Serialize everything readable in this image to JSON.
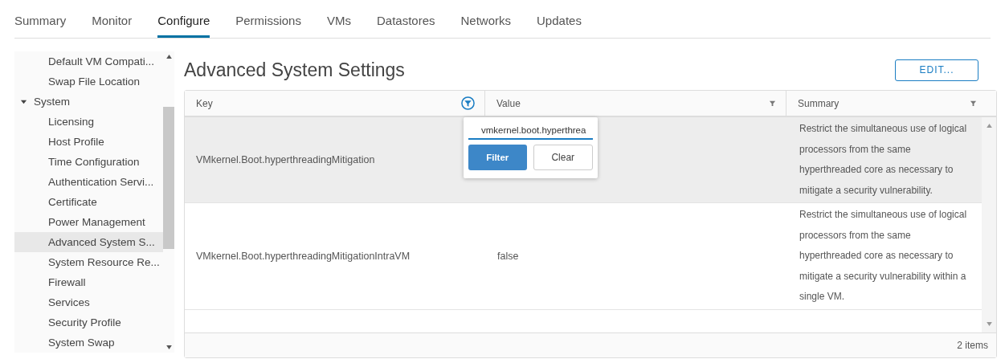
{
  "tabs": [
    {
      "label": "Summary",
      "selected": false
    },
    {
      "label": "Monitor",
      "selected": false
    },
    {
      "label": "Configure",
      "selected": true
    },
    {
      "label": "Permissions",
      "selected": false
    },
    {
      "label": "VMs",
      "selected": false
    },
    {
      "label": "Datastores",
      "selected": false
    },
    {
      "label": "Networks",
      "selected": false
    },
    {
      "label": "Updates",
      "selected": false
    }
  ],
  "sidebar": {
    "items": [
      {
        "label": "Default VM Compati...",
        "selected": false
      },
      {
        "label": "Swap File Location",
        "selected": false
      },
      {
        "label": "System",
        "selected": false,
        "expanded": true,
        "children": [
          {
            "label": "Licensing",
            "selected": false
          },
          {
            "label": "Host Profile",
            "selected": false
          },
          {
            "label": "Time Configuration",
            "selected": false
          },
          {
            "label": "Authentication Servi...",
            "selected": false
          },
          {
            "label": "Certificate",
            "selected": false
          },
          {
            "label": "Power Management",
            "selected": false
          },
          {
            "label": "Advanced System S...",
            "selected": true
          },
          {
            "label": "System Resource Re...",
            "selected": false
          },
          {
            "label": "Firewall",
            "selected": false
          },
          {
            "label": "Services",
            "selected": false
          },
          {
            "label": "Security Profile",
            "selected": false
          },
          {
            "label": "System Swap",
            "selected": false
          }
        ]
      }
    ]
  },
  "page": {
    "title": "Advanced System Settings",
    "edit_button": "EDIT..."
  },
  "table": {
    "columns": [
      {
        "label": "Key",
        "filter_active": true
      },
      {
        "label": "Value",
        "filter_active": false
      },
      {
        "label": "Summary",
        "filter_active": false
      }
    ],
    "rows": [
      {
        "selected": true,
        "cells": [
          "VMkernel.Boot.hyperthreadingMitigation",
          "",
          "Restrict the simultaneous use of logical processors from the same hyperthreaded core as necessary to mitigate a security vulnerability."
        ]
      },
      {
        "selected": false,
        "cells": [
          "VMkernel.Boot.hyperthreadingMitigationIntraVM",
          "false",
          "Restrict the simultaneous use of logical processors from the same hyperthreaded core as necessary to mitigate a security vulnerability within a single VM."
        ]
      }
    ],
    "footer": "2 items"
  },
  "filter_popup": {
    "value": "vmkernel.boot.hyperthrea",
    "filter_button": "Filter",
    "clear_button": "Clear"
  }
}
